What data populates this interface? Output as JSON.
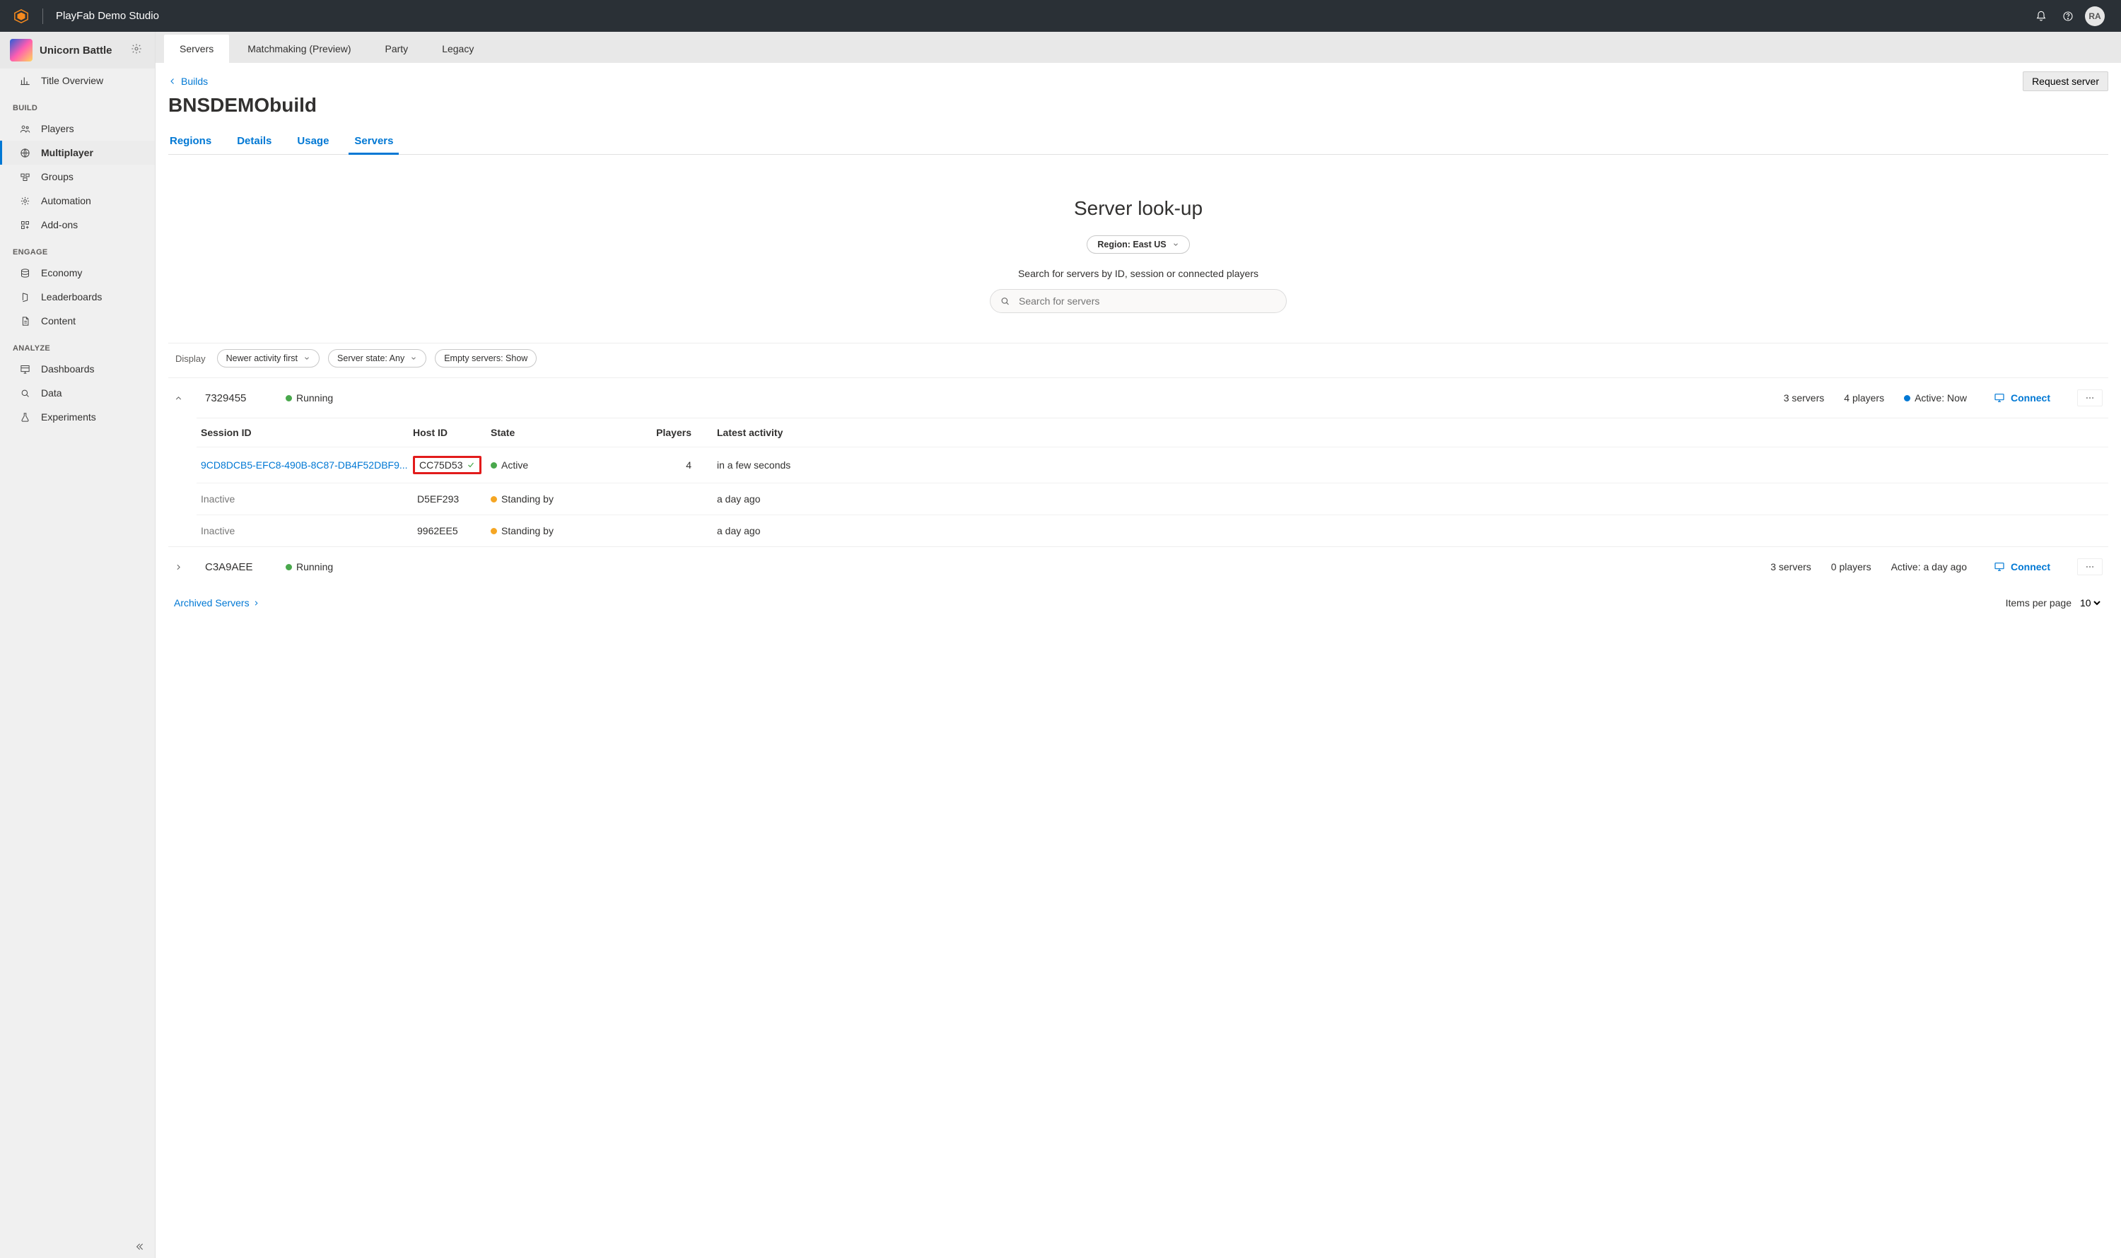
{
  "header": {
    "brand": "PlayFab Demo Studio",
    "avatar_initials": "RA"
  },
  "sidebar": {
    "title_name": "Unicorn Battle",
    "overview": "Title Overview",
    "sections": {
      "build": {
        "heading": "BUILD",
        "items": [
          "Players",
          "Multiplayer",
          "Groups",
          "Automation",
          "Add-ons"
        ]
      },
      "engage": {
        "heading": "ENGAGE",
        "items": [
          "Economy",
          "Leaderboards",
          "Content"
        ]
      },
      "analyze": {
        "heading": "ANALYZE",
        "items": [
          "Dashboards",
          "Data",
          "Experiments"
        ]
      }
    },
    "active": "Multiplayer"
  },
  "top_tabs": [
    "Servers",
    "Matchmaking (Preview)",
    "Party",
    "Legacy"
  ],
  "top_tab_active": "Servers",
  "breadcrumb": "Builds",
  "page_title": "BNSDEMObuild",
  "request_server_btn": "Request server",
  "sub_tabs": [
    "Regions",
    "Details",
    "Usage",
    "Servers"
  ],
  "sub_tab_active": "Servers",
  "lookup": {
    "title": "Server look-up",
    "region_label": "Region: East US",
    "hint": "Search for servers by ID, session or connected players",
    "placeholder": "Search for servers"
  },
  "filters": {
    "display_label": "Display",
    "sort": "Newer activity first",
    "state": "Server state: Any",
    "empty": "Empty servers: Show"
  },
  "table": {
    "columns": [
      "Session ID",
      "Host ID",
      "State",
      "Players",
      "Latest activity"
    ],
    "connect_label": "Connect",
    "groups": [
      {
        "id": "7329455",
        "status": "Running",
        "servers": "3 servers",
        "players": "4 players",
        "active": "Active: Now",
        "expanded": true,
        "rows": [
          {
            "session": "9CD8DCB5-EFC8-490B-8C87-DB4F52DBF9...",
            "host": "CC75D53",
            "state": "Active",
            "state_color": "green",
            "players": "4",
            "activity": "in a few seconds",
            "highlight_host": true,
            "session_active": true
          },
          {
            "session": "Inactive",
            "host": "D5EF293",
            "state": "Standing by",
            "state_color": "orange",
            "players": "",
            "activity": "a day ago",
            "session_active": false
          },
          {
            "session": "Inactive",
            "host": "9962EE5",
            "state": "Standing by",
            "state_color": "orange",
            "players": "",
            "activity": "a day ago",
            "session_active": false
          }
        ]
      },
      {
        "id": "C3A9AEE",
        "status": "Running",
        "servers": "3 servers",
        "players": "0 players",
        "active": "Active: a day ago",
        "expanded": false
      }
    ]
  },
  "footer": {
    "archived": "Archived Servers",
    "ipp_label": "Items per page",
    "ipp_value": "10"
  }
}
